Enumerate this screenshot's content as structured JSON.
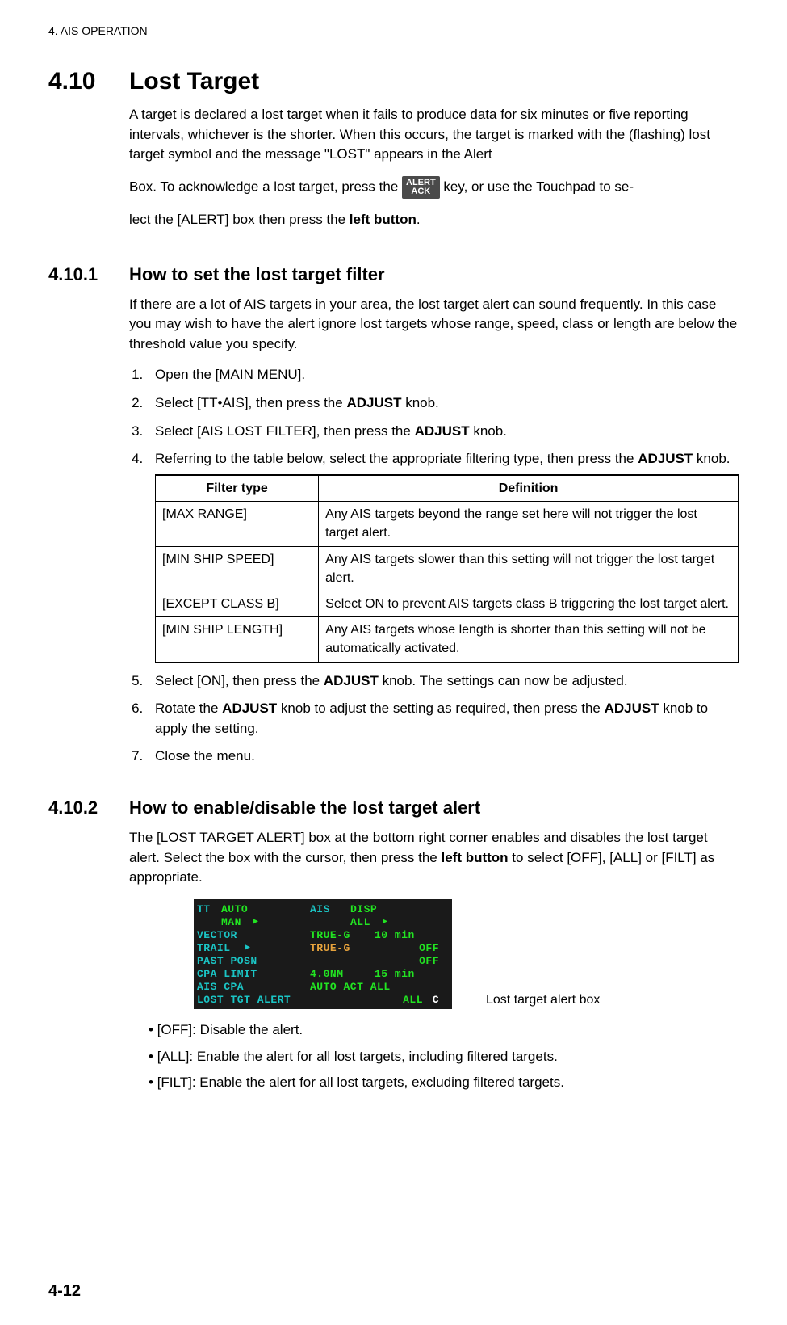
{
  "running_head": "4.  AIS OPERATION",
  "section": {
    "num": "4.10",
    "title": "Lost Target",
    "intro_a": "A target is declared a lost target when it fails to produce data for six minutes or five reporting intervals, whichever is the shorter. When this occurs, the target is marked with the (flashing) lost target symbol and the message \"LOST\" appears in the Alert",
    "intro_b_pre": "Box. To acknowledge a lost target, press the ",
    "keycap_top": "ALERT",
    "keycap_bot": "ACK",
    "intro_b_post": " key, or use the Touchpad to se-",
    "intro_c": "lect the [ALERT] box then press the ",
    "intro_c_bold": "left button",
    "intro_c_end": "."
  },
  "sub1": {
    "num": "4.10.1",
    "title": "How to set the lost target filter",
    "para": "If there are a lot of AIS targets in your area, the lost target alert can sound frequently. In this case you may wish to have the alert ignore lost targets whose range, speed, class or length are below the threshold value you specify.",
    "steps": {
      "s1": "Open the [MAIN MENU].",
      "s2_pre": "Select [TT•AIS], then press the ",
      "s2_bold": "ADJUST",
      "s2_post": " knob.",
      "s3_pre": "Select [AIS LOST FILTER], then press the ",
      "s3_bold": "ADJUST",
      "s3_post": " knob.",
      "s4_pre": "Referring to the table below, select the appropriate filtering type, then press the ",
      "s4_bold": "ADJUST",
      "s4_post": " knob.",
      "s5_pre": "Select [ON], then press the ",
      "s5_bold": "ADJUST",
      "s5_post": " knob. The settings can now be adjusted.",
      "s6_pre": "Rotate the ",
      "s6_b1": "ADJUST",
      "s6_mid": " knob to adjust the setting as required, then press the ",
      "s6_b2": "ADJUST",
      "s6_post": " knob to apply the setting.",
      "s7": "Close the menu."
    },
    "table": {
      "h1": "Filter type",
      "h2": "Definition",
      "rows": [
        {
          "t": "[MAX RANGE]",
          "d": "Any AIS targets beyond the range set here will not trigger the lost target alert."
        },
        {
          "t": "[MIN SHIP SPEED]",
          "d": "Any AIS targets slower than this setting will not trigger the lost target alert."
        },
        {
          "t": "[EXCEPT CLASS B]",
          "d": "Select ON to prevent AIS targets class B triggering the lost target alert."
        },
        {
          "t": "[MIN SHIP LENGTH]",
          "d": "Any AIS targets whose length is shorter than this setting will not be automatically activated."
        }
      ]
    }
  },
  "sub2": {
    "num": "4.10.2",
    "title": "How to enable/disable the lost target alert",
    "para_pre": "The [LOST TARGET ALERT] box at the bottom right corner enables and disables the lost target alert. Select the box with the cursor, then press the ",
    "para_bold": "left button",
    "para_post": " to select [OFF], [ALL] or [FILT] as appropriate.",
    "callout": "Lost target alert box",
    "panel": {
      "r1": {
        "a": "TT",
        "b": "AUTO",
        "c": "",
        "d": "AIS",
        "e": "DISP"
      },
      "r1b": {
        "b": "MAN",
        "c": "▶",
        "e": "ALL",
        "f": "▶"
      },
      "r2": {
        "a": "VECTOR",
        "b": "TRUE-G",
        "c": "10 min"
      },
      "r3": {
        "a": "TRAIL",
        "ar": "▶",
        "b": "TRUE-G",
        "c": "OFF"
      },
      "r4": {
        "a": "PAST POSN",
        "c": "OFF"
      },
      "r5": {
        "a": "CPA LIMIT",
        "b": "4.0NM",
        "c": "15 min"
      },
      "r6": {
        "a": "AIS CPA",
        "b": "AUTO ACT ALL"
      },
      "r7": {
        "a": "LOST TGT ALERT",
        "b": "ALL",
        "c": "C"
      }
    },
    "bullets": [
      "[OFF]: Disable the alert.",
      "[ALL]: Enable the alert for all lost targets, including filtered targets.",
      "[FILT]: Enable the alert for all lost targets, excluding filtered targets."
    ]
  },
  "page_num": "4-12"
}
